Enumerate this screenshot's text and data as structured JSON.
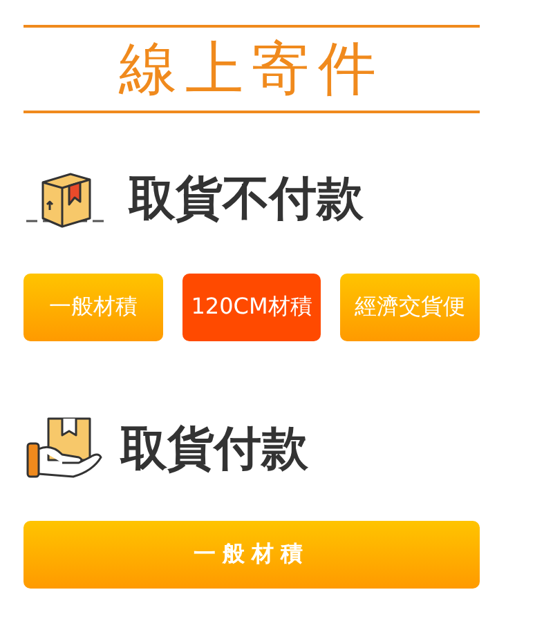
{
  "title": "線上寄件",
  "sections": [
    {
      "heading": "取貨不付款",
      "buttons": [
        {
          "label": "一般材積",
          "selected": false
        },
        {
          "label": "120CM材積",
          "selected": true
        },
        {
          "label": "經濟交貨便",
          "selected": false
        }
      ]
    },
    {
      "heading": "取貨付款",
      "buttons": [
        {
          "label": "一般材積",
          "selected": false
        }
      ]
    }
  ]
}
